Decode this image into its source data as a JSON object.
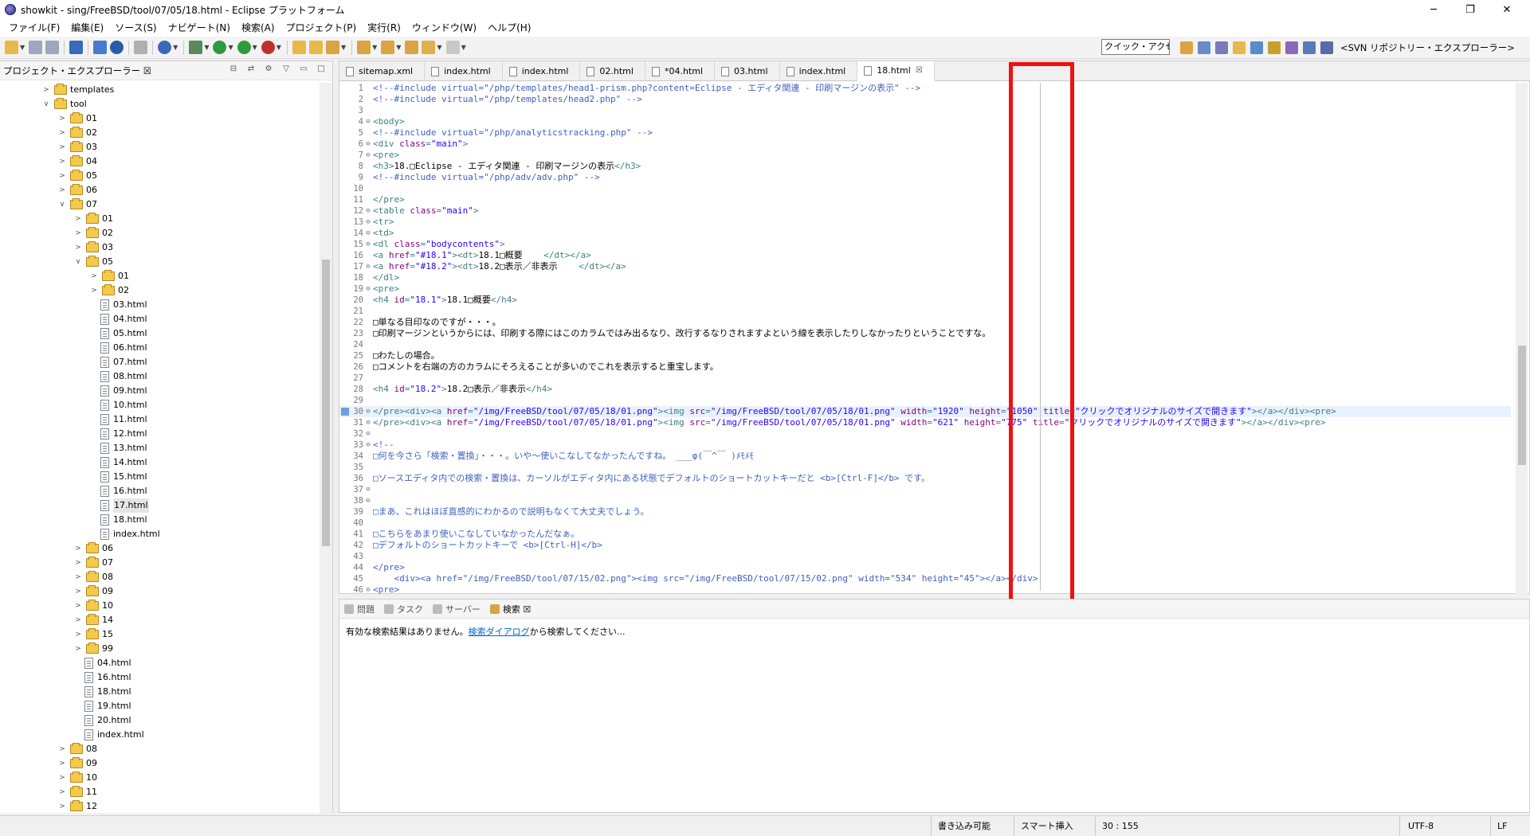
{
  "window": {
    "title": "showkit - sing/FreeBSD/tool/07/05/18.html - Eclipse プラットフォーム",
    "minimize": "─",
    "maximize": "❐",
    "close": "✕"
  },
  "menu": [
    "ファイル(F)",
    "編集(E)",
    "ソース(S)",
    "ナビゲート(N)",
    "検索(A)",
    "プロジェクト(P)",
    "実行(R)",
    "ウィンドウ(W)",
    "ヘルプ(H)"
  ],
  "quick_access": "クイック・アクセス",
  "perspective_label": "<SVN リポジトリー・エクスプローラー>",
  "explorer": {
    "title": "プロジェクト・エクスプローラー ☒",
    "items": [
      {
        "label": "templates",
        "type": "folder",
        "depth": 1,
        "state": "collapsed"
      },
      {
        "label": "tool",
        "type": "folder",
        "depth": 1,
        "state": "expanded"
      },
      {
        "label": "01",
        "type": "folder",
        "depth": 2,
        "state": "collapsed"
      },
      {
        "label": "02",
        "type": "folder",
        "depth": 2,
        "state": "collapsed"
      },
      {
        "label": "03",
        "type": "folder",
        "depth": 2,
        "state": "collapsed"
      },
      {
        "label": "04",
        "type": "folder",
        "depth": 2,
        "state": "collapsed"
      },
      {
        "label": "05",
        "type": "folder",
        "depth": 2,
        "state": "collapsed"
      },
      {
        "label": "06",
        "type": "folder",
        "depth": 2,
        "state": "collapsed"
      },
      {
        "label": "07",
        "type": "folder",
        "depth": 2,
        "state": "expanded"
      },
      {
        "label": "01",
        "type": "folder",
        "depth": 3,
        "state": "collapsed"
      },
      {
        "label": "02",
        "type": "folder",
        "depth": 3,
        "state": "collapsed"
      },
      {
        "label": "03",
        "type": "folder",
        "depth": 3,
        "state": "collapsed"
      },
      {
        "label": "05",
        "type": "folder",
        "depth": 3,
        "state": "expanded"
      },
      {
        "label": "01",
        "type": "folder",
        "depth": 4,
        "state": "collapsed"
      },
      {
        "label": "02",
        "type": "folder",
        "depth": 4,
        "state": "collapsed"
      },
      {
        "label": "03.html",
        "type": "file",
        "depth": 4
      },
      {
        "label": "04.html",
        "type": "file",
        "depth": 4
      },
      {
        "label": "05.html",
        "type": "file",
        "depth": 4
      },
      {
        "label": "06.html",
        "type": "file",
        "depth": 4
      },
      {
        "label": "07.html",
        "type": "file",
        "depth": 4
      },
      {
        "label": "08.html",
        "type": "file",
        "depth": 4
      },
      {
        "label": "09.html",
        "type": "file",
        "depth": 4
      },
      {
        "label": "10.html",
        "type": "file",
        "depth": 4
      },
      {
        "label": "11.html",
        "type": "file",
        "depth": 4
      },
      {
        "label": "12.html",
        "type": "file",
        "depth": 4
      },
      {
        "label": "13.html",
        "type": "file",
        "depth": 4
      },
      {
        "label": "14.html",
        "type": "file",
        "depth": 4
      },
      {
        "label": "15.html",
        "type": "file",
        "depth": 4
      },
      {
        "label": "16.html",
        "type": "file",
        "depth": 4
      },
      {
        "label": "17.html",
        "type": "file",
        "depth": 4,
        "selected": true
      },
      {
        "label": "18.html",
        "type": "file",
        "depth": 4
      },
      {
        "label": "index.html",
        "type": "file",
        "depth": 4
      },
      {
        "label": "06",
        "type": "folder",
        "depth": 3,
        "state": "collapsed"
      },
      {
        "label": "07",
        "type": "folder",
        "depth": 3,
        "state": "collapsed"
      },
      {
        "label": "08",
        "type": "folder",
        "depth": 3,
        "state": "collapsed"
      },
      {
        "label": "09",
        "type": "folder",
        "depth": 3,
        "state": "collapsed"
      },
      {
        "label": "10",
        "type": "folder",
        "depth": 3,
        "state": "collapsed"
      },
      {
        "label": "14",
        "type": "folder",
        "depth": 3,
        "state": "collapsed"
      },
      {
        "label": "15",
        "type": "folder",
        "depth": 3,
        "state": "collapsed"
      },
      {
        "label": "99",
        "type": "folder",
        "depth": 3,
        "state": "collapsed"
      },
      {
        "label": "04.html",
        "type": "file",
        "depth": 3
      },
      {
        "label": "16.html",
        "type": "file",
        "depth": 3
      },
      {
        "label": "18.html",
        "type": "file",
        "depth": 3
      },
      {
        "label": "19.html",
        "type": "file",
        "depth": 3
      },
      {
        "label": "20.html",
        "type": "file",
        "depth": 3
      },
      {
        "label": "index.html",
        "type": "file",
        "depth": 3
      },
      {
        "label": "08",
        "type": "folder",
        "depth": 2,
        "state": "collapsed"
      },
      {
        "label": "09",
        "type": "folder",
        "depth": 2,
        "state": "collapsed"
      },
      {
        "label": "10",
        "type": "folder",
        "depth": 2,
        "state": "collapsed"
      },
      {
        "label": "11",
        "type": "folder",
        "depth": 2,
        "state": "collapsed"
      },
      {
        "label": "12",
        "type": "folder",
        "depth": 2,
        "state": "collapsed"
      }
    ]
  },
  "tabs": [
    {
      "label": "sitemap.xml",
      "active": false
    },
    {
      "label": "index.html",
      "active": false
    },
    {
      "label": "index.html",
      "active": false
    },
    {
      "label": "02.html",
      "active": false
    },
    {
      "label": "*04.html",
      "active": false
    },
    {
      "label": "03.html",
      "active": false
    },
    {
      "label": "index.html",
      "active": false
    },
    {
      "label": "18.html",
      "active": true
    }
  ],
  "editor": {
    "current_line": 30,
    "lines": [
      {
        "n": "1",
        "fold": "",
        "seg": [
          [
            "cmt",
            "<!--#include virtual=\"/php/templates/head1-prism.php?content=Eclipse - エディタ関連 - 印刷マージンの表示\" -->"
          ]
        ]
      },
      {
        "n": "2",
        "fold": "",
        "seg": [
          [
            "cmt",
            "<!--#include virtual=\"/php/templates/head2.php\" -->"
          ]
        ]
      },
      {
        "n": "3",
        "fold": "",
        "seg": []
      },
      {
        "n": "4",
        "fold": "⊖",
        "seg": [
          [
            "tag",
            "<body>"
          ]
        ]
      },
      {
        "n": "5",
        "fold": "",
        "seg": [
          [
            "cmt",
            "<!--#include virtual=\"/php/analyticstracking.php\" -->"
          ]
        ]
      },
      {
        "n": "6",
        "fold": "⊖",
        "seg": [
          [
            "tag",
            "<div "
          ],
          [
            "att",
            "class"
          ],
          [
            "tag",
            "="
          ],
          [
            "val",
            "\"main\""
          ],
          [
            "tag",
            ">"
          ]
        ]
      },
      {
        "n": "7",
        "fold": "⊖",
        "seg": [
          [
            "tag",
            "<pre>"
          ]
        ]
      },
      {
        "n": "8",
        "fold": "",
        "seg": [
          [
            "tag",
            "<h3>"
          ],
          [
            "txt",
            "18.□Eclipse - エディタ関連 - 印刷マージンの表示"
          ],
          [
            "tag",
            "</h3>"
          ]
        ]
      },
      {
        "n": "9",
        "fold": "",
        "seg": [
          [
            "cmt",
            "<!--#include virtual=\"/php/adv/adv.php\" -->"
          ]
        ]
      },
      {
        "n": "10",
        "fold": "",
        "seg": []
      },
      {
        "n": "11",
        "fold": "",
        "seg": [
          [
            "tag",
            "</pre>"
          ]
        ]
      },
      {
        "n": "12",
        "fold": "⊖",
        "seg": [
          [
            "tag",
            "<table "
          ],
          [
            "att",
            "class"
          ],
          [
            "tag",
            "="
          ],
          [
            "val",
            "\"main\""
          ],
          [
            "tag",
            ">"
          ]
        ]
      },
      {
        "n": "13",
        "fold": "⊖",
        "seg": [
          [
            "tag",
            "<tr>"
          ]
        ]
      },
      {
        "n": "14",
        "fold": "⊖",
        "seg": [
          [
            "tag",
            "<td>"
          ]
        ]
      },
      {
        "n": "15",
        "fold": "⊖",
        "seg": [
          [
            "tag",
            "<dl "
          ],
          [
            "att",
            "class"
          ],
          [
            "tag",
            "="
          ],
          [
            "val",
            "\"bodycontents\""
          ],
          [
            "tag",
            ">"
          ]
        ]
      },
      {
        "n": "16",
        "fold": "",
        "seg": [
          [
            "tag",
            "<a "
          ],
          [
            "att",
            "href"
          ],
          [
            "tag",
            "="
          ],
          [
            "val",
            "\"#18.1\""
          ],
          [
            "tag",
            "><dt>"
          ],
          [
            "txt",
            "18.1□概要"
          ],
          [
            "tag",
            "    </dt></a>"
          ]
        ]
      },
      {
        "n": "17",
        "fold": "⊖",
        "seg": [
          [
            "tag",
            "<a "
          ],
          [
            "att",
            "href"
          ],
          [
            "tag",
            "="
          ],
          [
            "val",
            "\"#18.2\""
          ],
          [
            "tag",
            "><dt>"
          ],
          [
            "txt",
            "18.2□表示／非表示"
          ],
          [
            "tag",
            "    </dt></a>"
          ]
        ]
      },
      {
        "n": "18",
        "fold": "",
        "seg": [
          [
            "tag",
            "</dl>"
          ]
        ]
      },
      {
        "n": "19",
        "fold": "⊖",
        "seg": [
          [
            "tag",
            "<pre>"
          ]
        ]
      },
      {
        "n": "20",
        "fold": "",
        "seg": [
          [
            "tag",
            "<h4 "
          ],
          [
            "att",
            "id"
          ],
          [
            "tag",
            "="
          ],
          [
            "val",
            "\"18.1\""
          ],
          [
            "tag",
            ">"
          ],
          [
            "txt",
            "18.1□概要"
          ],
          [
            "tag",
            "</h4>"
          ]
        ]
      },
      {
        "n": "21",
        "fold": "",
        "seg": []
      },
      {
        "n": "22",
        "fold": "",
        "seg": [
          [
            "txt",
            "□単なる目印なのですが・・・。"
          ]
        ]
      },
      {
        "n": "23",
        "fold": "",
        "seg": [
          [
            "txt",
            "□印刷マージンというからには、印刷する際にはこのカラムではみ出るなり、改行するなりされますよという線を表示したりしなかったりということですな。"
          ]
        ]
      },
      {
        "n": "24",
        "fold": "",
        "seg": []
      },
      {
        "n": "25",
        "fold": "",
        "seg": [
          [
            "txt",
            "□わたしの場合。"
          ]
        ]
      },
      {
        "n": "26",
        "fold": "",
        "seg": [
          [
            "txt",
            "□コメントを右端の方のカラムにそろえることが多いのでこれを表示すると重宝します。"
          ]
        ]
      },
      {
        "n": "27",
        "fold": "",
        "seg": []
      },
      {
        "n": "28",
        "fold": "",
        "seg": [
          [
            "tag",
            "<h4 "
          ],
          [
            "att",
            "id"
          ],
          [
            "tag",
            "="
          ],
          [
            "val",
            "\"18.2\""
          ],
          [
            "tag",
            ">"
          ],
          [
            "txt",
            "18.2□表示／非表示"
          ],
          [
            "tag",
            "</h4>"
          ]
        ]
      },
      {
        "n": "29",
        "fold": "",
        "seg": []
      },
      {
        "n": "30",
        "fold": "⊖",
        "seg": [
          [
            "tag",
            "</pre><div><a "
          ],
          [
            "att",
            "href"
          ],
          [
            "tag",
            "="
          ],
          [
            "val",
            "\"/img/FreeBSD/tool/07/05/18/01.png\""
          ],
          [
            "tag",
            "><img "
          ],
          [
            "att",
            "src"
          ],
          [
            "tag",
            "="
          ],
          [
            "val",
            "\"/img/FreeBSD/tool/07/05/18/01.png\""
          ],
          [
            "att",
            " width"
          ],
          [
            "tag",
            "="
          ],
          [
            "val",
            "\"1920\""
          ],
          [
            "att",
            " height"
          ],
          [
            "tag",
            "="
          ],
          [
            "val",
            "\"1050\""
          ],
          [
            "att",
            " title"
          ],
          [
            "tag",
            "="
          ],
          [
            "val",
            "\"クリックでオリジナルのサイズで開きます\""
          ],
          [
            "tag",
            "></a></div><pre>"
          ]
        ]
      },
      {
        "n": "31",
        "fold": "⊖",
        "seg": [
          [
            "tag",
            "</pre><div><a "
          ],
          [
            "att",
            "href"
          ],
          [
            "tag",
            "="
          ],
          [
            "val",
            "\"/img/FreeBSD/tool/07/05/18/01.png\""
          ],
          [
            "tag",
            "><img "
          ],
          [
            "att",
            "src"
          ],
          [
            "tag",
            "="
          ],
          [
            "val",
            "\"/img/FreeBSD/tool/07/05/18/01.png\""
          ],
          [
            "att",
            " width"
          ],
          [
            "tag",
            "="
          ],
          [
            "val",
            "\"621\""
          ],
          [
            "att",
            " height"
          ],
          [
            "tag",
            "="
          ],
          [
            "val",
            "\"775\""
          ],
          [
            "att",
            " title"
          ],
          [
            "tag",
            "="
          ],
          [
            "val",
            "\"クリックでオリジナルのサイズで開きます\""
          ],
          [
            "tag",
            "></a></div><pre>"
          ]
        ]
      },
      {
        "n": "32",
        "fold": "⊖",
        "seg": []
      },
      {
        "n": "33",
        "fold": "⊖",
        "seg": [
          [
            "cmt",
            "<!--"
          ]
        ]
      },
      {
        "n": "34",
        "fold": "",
        "seg": [
          [
            "cmt",
            "□何を今さら「検索・置換」・・・。いや～使いこなしてなかったんですね。 ___φ(￣^￣ )ﾒﾓﾒﾓ"
          ]
        ]
      },
      {
        "n": "35",
        "fold": "",
        "seg": []
      },
      {
        "n": "36",
        "fold": "",
        "seg": [
          [
            "cmt",
            "□ソースエディタ内での検索・置換は、カーソルがエディタ内にある状態でデフォルトのショートカットキーだと <b>[Ctrl-F]</b> です。"
          ]
        ]
      },
      {
        "n": "37",
        "fold": "⊖",
        "seg": []
      },
      {
        "n": "38",
        "fold": "⊖",
        "seg": []
      },
      {
        "n": "39",
        "fold": "",
        "seg": [
          [
            "cmt",
            "□まあ、これはほぼ直感的にわかるので説明もなくて大丈夫でしょう。"
          ]
        ]
      },
      {
        "n": "40",
        "fold": "",
        "seg": []
      },
      {
        "n": "41",
        "fold": "",
        "seg": [
          [
            "cmt",
            "□こちらをあまり使いこなしていなかったんだなぁ。"
          ]
        ]
      },
      {
        "n": "42",
        "fold": "",
        "seg": [
          [
            "cmt",
            "□デフォルトのショートカットキーで <b>[Ctrl-H]</b>"
          ]
        ]
      },
      {
        "n": "43",
        "fold": "",
        "seg": []
      },
      {
        "n": "44",
        "fold": "",
        "seg": [
          [
            "cmt",
            "</pre>"
          ]
        ]
      },
      {
        "n": "45",
        "fold": "",
        "seg": [
          [
            "cmt",
            "    <div><a href=\"/img/FreeBSD/tool/07/15/02.png\"><img src=\"/img/FreeBSD/tool/07/15/02.png\" width=\"534\" height=\"45\"></a></div>"
          ]
        ]
      },
      {
        "n": "46",
        "fold": "⊖",
        "seg": [
          [
            "cmt",
            "<pre>"
          ]
        ]
      }
    ]
  },
  "bottom": {
    "tabs": [
      {
        "label": "問題",
        "active": false
      },
      {
        "label": "タスク",
        "active": false
      },
      {
        "label": "サーバー",
        "active": false
      },
      {
        "label": "検索 ☒",
        "active": true
      }
    ],
    "message_before": "有効な検索結果はありません。",
    "message_link": "検索ダイアログ",
    "message_after": "から検索してください..."
  },
  "status": {
    "writable": "書き込み可能",
    "insert_mode": "スマート挿入",
    "position": "30 : 155",
    "encoding": "UTF-8",
    "line_ending": "LF"
  },
  "colors": {
    "comment": "#3f5fbf",
    "tag": "#3f7f7f",
    "attribute": "#7f007f",
    "value": "#2a00ff",
    "highlight_box": "#ee1111"
  }
}
